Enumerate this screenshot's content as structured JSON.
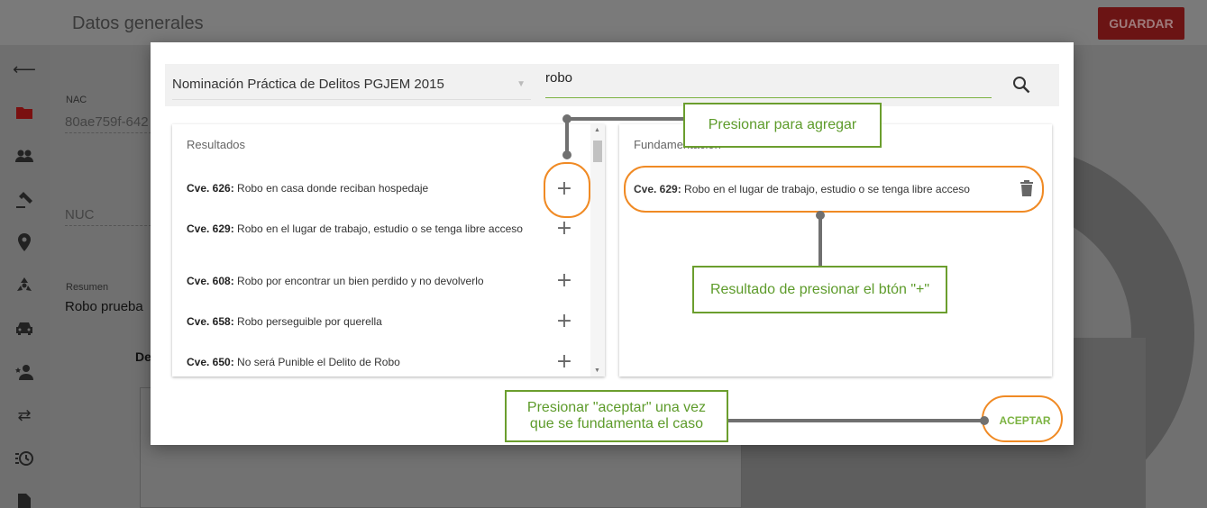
{
  "app": {
    "page_title": "Datos generales",
    "save_label": "GUARDAR"
  },
  "background": {
    "nac_label": "NAC",
    "nac_value": "80ae759f-642",
    "nuc_label": "NUC",
    "summary_label": "Resumen",
    "summary_value": "Robo prueba",
    "section_fragment": "De"
  },
  "sidebar": {
    "icons": [
      "back-arrow-icon",
      "folder-icon",
      "people-icon",
      "gavel-icon",
      "location-pin-icon",
      "hazard-icon",
      "car-icon",
      "person-star-icon",
      "swap-icon",
      "history-icon",
      "document-icon"
    ]
  },
  "dialog": {
    "catalog_select": "Nominación Práctica de Delitos PGJEM 2015",
    "search_value": "robo",
    "results_title": "Resultados",
    "results": [
      {
        "code": "Cve. 626:",
        "text": "Robo en casa donde reciban hospedaje"
      },
      {
        "code": "Cve. 629:",
        "text": "Robo en el lugar de trabajo, estudio o se tenga libre acceso"
      },
      {
        "code": "Cve. 608:",
        "text": "Robo por encontrar un bien perdido y no devolverlo"
      },
      {
        "code": "Cve. 658:",
        "text": "Robo perseguible por querella"
      },
      {
        "code": "Cve. 650:",
        "text": "No será Punible el Delito de Robo"
      }
    ],
    "fund_title": "Fundamentación",
    "fund_items": [
      {
        "code": "Cve. 629:",
        "text": "Robo en el lugar de trabajo, estudio o se tenga libre acceso"
      }
    ],
    "accept_label": "ACEPTAR"
  },
  "annotations": {
    "add_hint": "Presionar para agregar",
    "result_hint": "Resultado de presionar el btón \"+\"",
    "accept_hint": "Presionar \"aceptar\" una vez que se fundamenta el caso"
  },
  "colors": {
    "accent_green": "#7cb342",
    "annotation_ring": "#f08a24",
    "save_red": "#6b1414"
  }
}
